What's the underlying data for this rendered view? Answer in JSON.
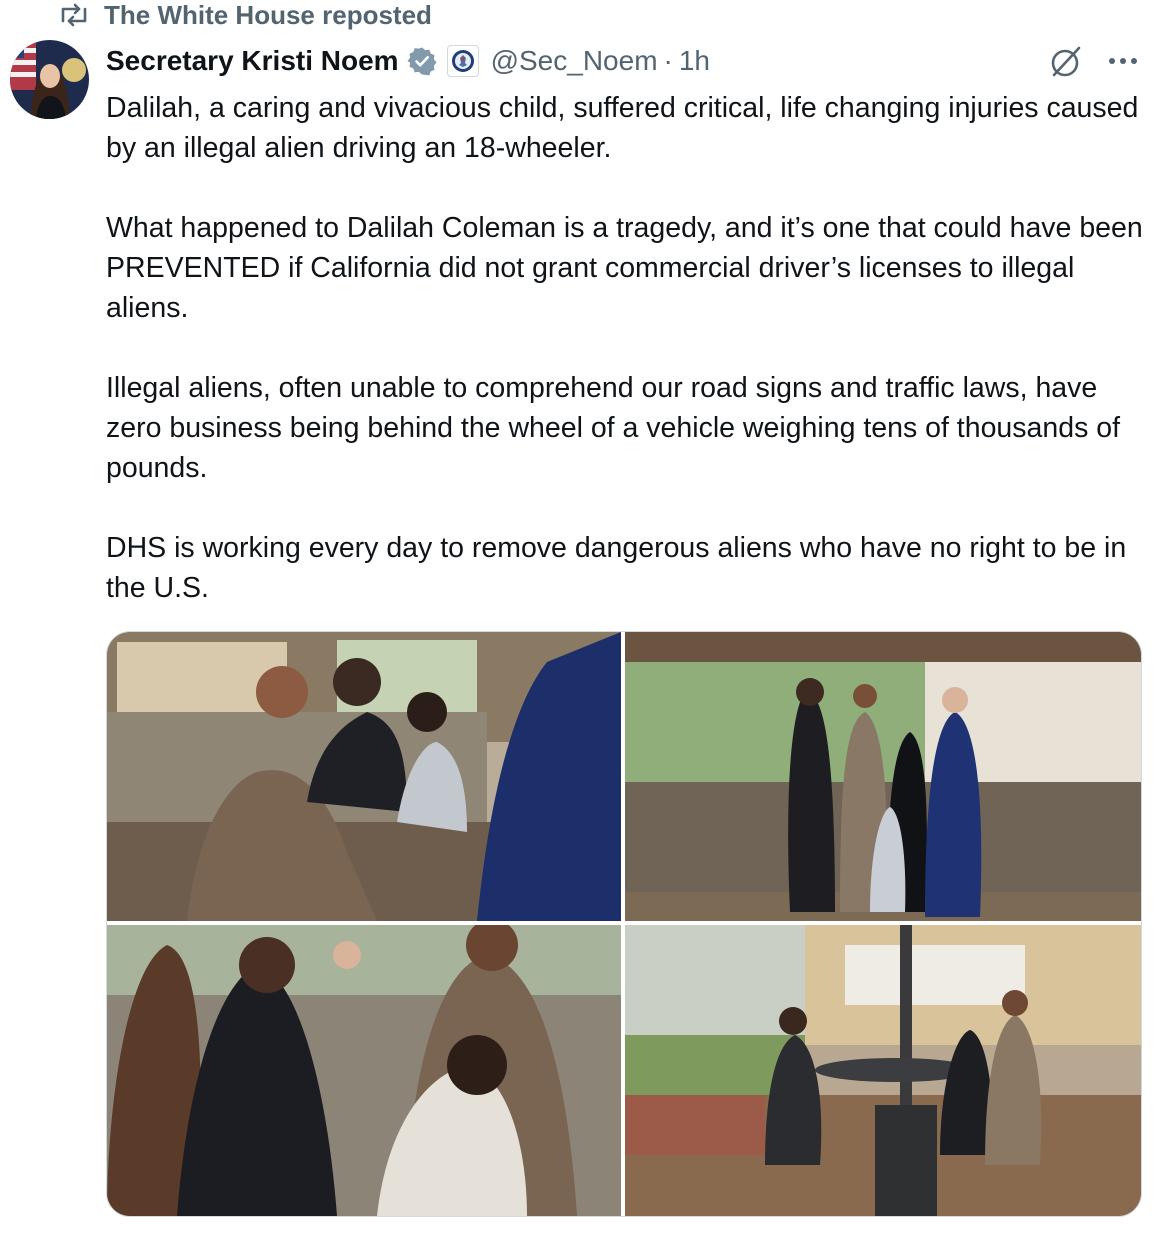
{
  "repost": {
    "text": "The White House reposted"
  },
  "author": {
    "name": "Secretary Kristi Noem",
    "handle": "@Sec_Noem",
    "separator": "·",
    "time": "1h"
  },
  "icons": {
    "repost": "repost-icon",
    "verified": "verified-badge-icon",
    "affiliation": "dhs-seal-icon",
    "grok": "grok-icon",
    "more": "more-options-icon"
  },
  "colors": {
    "text": "#0f1419",
    "secondary": "#536471",
    "verified": "#829aab"
  },
  "tweet": {
    "paragraphs": [
      "Dalilah, a caring and vivacious child, suffered critical, life changing injuries caused by an illegal alien driving an 18-wheeler.",
      "What happened to Dalilah Coleman is a tragedy, and it’s one that could have been PREVENTED if California did not grant commercial driver’s licenses to illegal aliens.",
      "Illegal aliens, often unable to comprehend our road signs and traffic laws, have zero business being behind the wheel of a vehicle weighing tens of thousands of pounds.",
      "DHS is working every day to remove dangerous aliens who have no right to be in the U.S."
    ]
  },
  "media": {
    "photo_count": 4
  }
}
